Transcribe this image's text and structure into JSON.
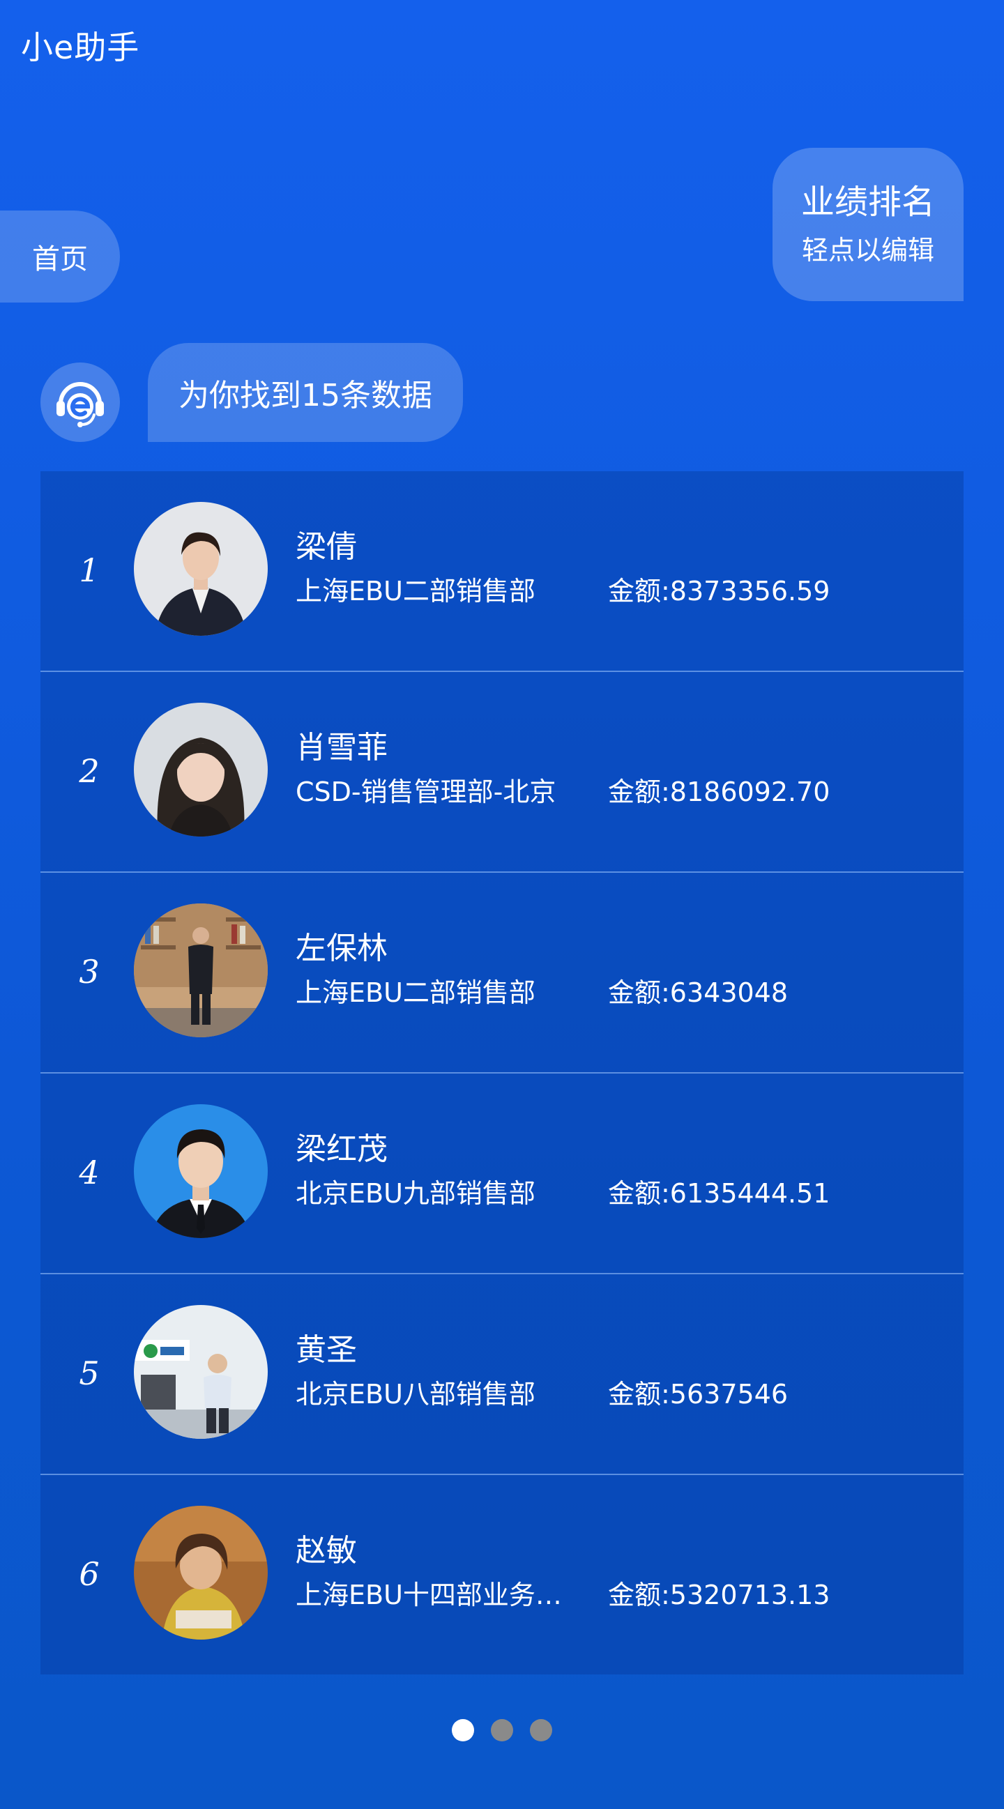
{
  "app": {
    "title": "小e助手"
  },
  "nav": {
    "home_label": "首页"
  },
  "user_message": {
    "text": "业绩排名",
    "hint": "轻点以编辑"
  },
  "bot_message": {
    "text": "为你找到15条数据"
  },
  "ranking": [
    {
      "rank": "1",
      "name": "梁倩",
      "department": "上海EBU二部销售部",
      "amount": "金额:8373356.59",
      "photo": "woman-dark-suit"
    },
    {
      "rank": "2",
      "name": "肖雪菲",
      "department": "CSD-销售管理部-北京",
      "amount": "金额:8186092.70",
      "photo": "woman-light-background"
    },
    {
      "rank": "3",
      "name": "左保林",
      "department": "上海EBU二部销售部",
      "amount": "金额:6343048",
      "photo": "man-standing-bookshelf"
    },
    {
      "rank": "4",
      "name": "梁红茂",
      "department": "北京EBU九部销售部",
      "amount": "金额:6135444.51",
      "photo": "man-blue-background"
    },
    {
      "rank": "5",
      "name": "黄圣",
      "department": "北京EBU八部销售部",
      "amount": "金额:5637546",
      "photo": "man-office-reception"
    },
    {
      "rank": "6",
      "name": "赵敏",
      "department": "上海EBU十四部业务…",
      "amount": "金额:5320713.13",
      "photo": "woman-warm-room"
    }
  ],
  "pagination": {
    "pages": 3,
    "current": 1
  },
  "colors": {
    "background_top": "#1460ec",
    "background_bottom": "#0a57c9",
    "row_background": "#0b4fb8",
    "dot_active": "#ffffff",
    "dot_inactive": "#8a8a8a"
  }
}
